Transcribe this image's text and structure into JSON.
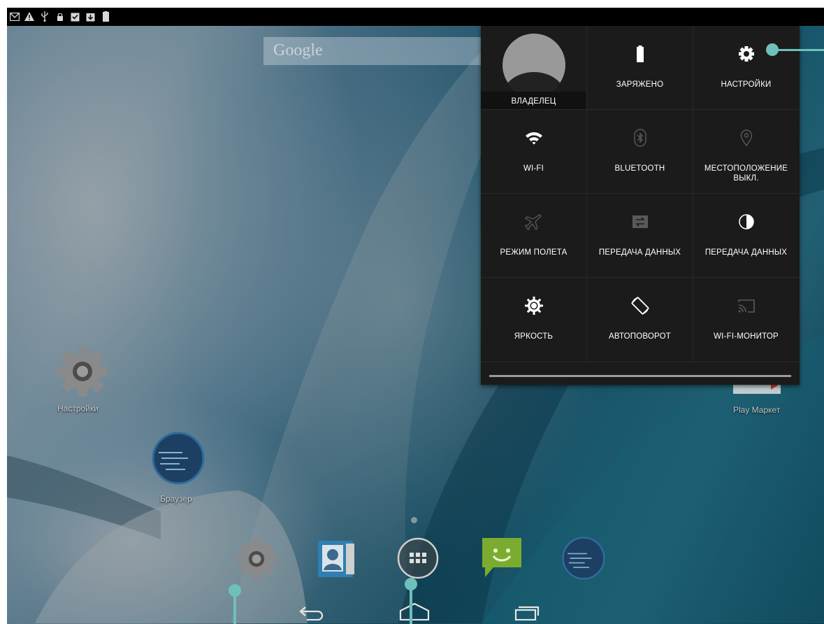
{
  "status_bar": {
    "icons": [
      "gmail-icon",
      "warning-icon",
      "usb-icon",
      "lock-icon",
      "clipboard-check-icon",
      "download-icon",
      "battery-icon"
    ]
  },
  "google_search": {
    "label": "Google"
  },
  "quick_settings": {
    "owner": {
      "label": "ВЛАДЕЛЕЦ"
    },
    "battery": {
      "label": "ЗАРЯЖЕНО"
    },
    "settings": {
      "label": "НАСТРОЙКИ"
    },
    "wifi": {
      "label": "WI-FI"
    },
    "bluetooth": {
      "label": "BLUETOOTH"
    },
    "location": {
      "label": "МЕСТОПОЛОЖЕНИЕ ВЫКЛ."
    },
    "airplane": {
      "label": "РЕЖИМ ПОЛЕТА"
    },
    "mobile_data": {
      "label": "ПЕРЕДАЧА ДАННЫХ"
    },
    "data_usage": {
      "label": "ПЕРЕДАЧА ДАННЫХ"
    },
    "brightness": {
      "label": "ЯРКОСТЬ"
    },
    "autorotate": {
      "label": "АВТОПОВОРОТ"
    },
    "wifi_display": {
      "label": "WI-FI-МОНИТОР"
    }
  },
  "home_screen": {
    "shortcuts": [
      {
        "label": "Настройки"
      },
      {
        "label": "Браузер"
      },
      {
        "label": "Play Маркет"
      }
    ]
  },
  "dock": {
    "items": [
      "settings-icon",
      "contacts-icon",
      "app-drawer-icon",
      "messaging-icon",
      "browser-icon"
    ]
  },
  "nav_bar": {
    "items": [
      "back-icon",
      "home-icon",
      "recents-icon"
    ]
  },
  "colors": {
    "callout": "#6fbfbb",
    "panel_bg": "#1b1b1b",
    "status_bar": "#000000"
  }
}
